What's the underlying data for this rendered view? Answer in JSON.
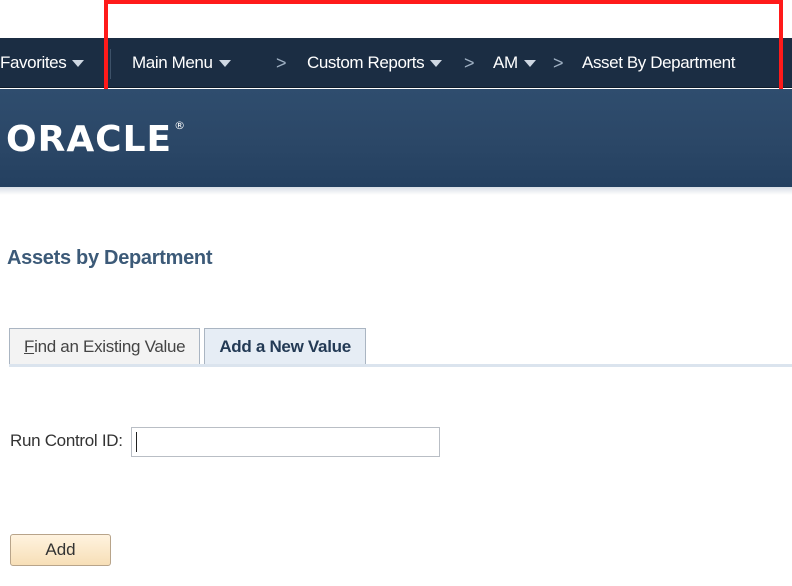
{
  "top_strip": {
    "glyphs": ""
  },
  "navbar": {
    "favorites": "Favorites",
    "main_menu": "Main Menu",
    "breadcrumbs": [
      "Custom Reports",
      "AM",
      "Asset By Department"
    ],
    "arrow": ">"
  },
  "brand": {
    "logo": "ORACLE",
    "reg_mark": "®"
  },
  "page": {
    "title": "Assets by Department",
    "tabs": [
      {
        "first_letter": "F",
        "rest": "ind an Existing Value",
        "state": "inactive"
      },
      {
        "label": "Add a New Value",
        "state": "active"
      }
    ],
    "run_control": {
      "label": "Run Control ID:",
      "value": ""
    },
    "add_button": "Add"
  },
  "colors": {
    "navbar": "#1b2d43",
    "brand_bar": "#2b4767",
    "highlight": "#ff1a1a",
    "title": "#3c5a78",
    "add_button": "#f7dfb7"
  }
}
